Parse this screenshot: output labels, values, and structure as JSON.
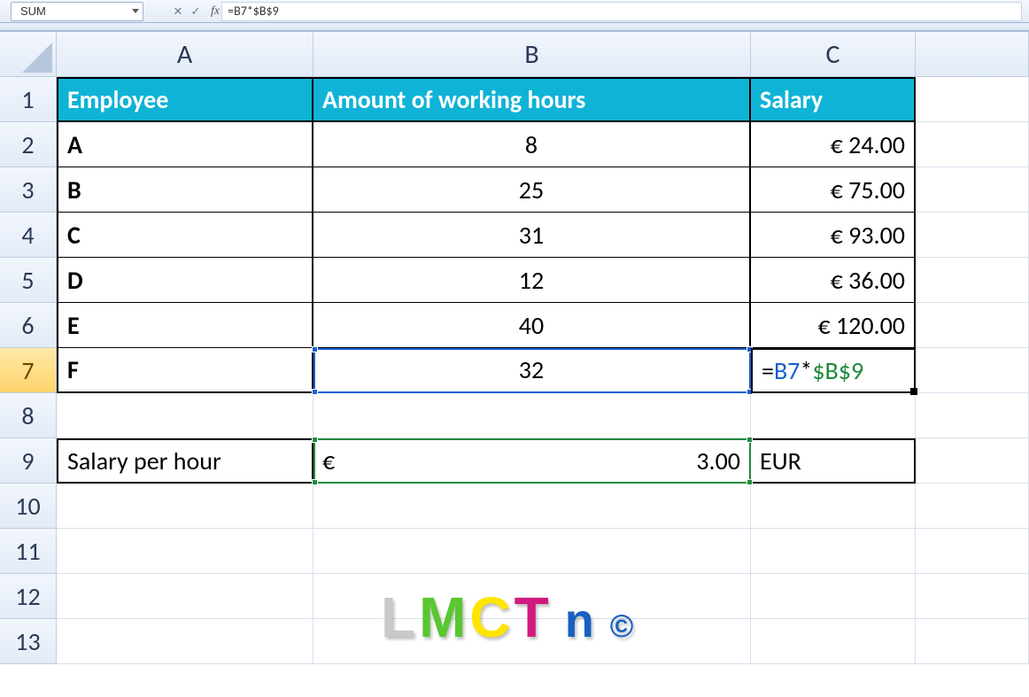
{
  "formula_bar": {
    "name_box": "SUM",
    "fx_label": "fx",
    "cancel": "✕",
    "accept": "✓",
    "formula": "=B7*$B$9"
  },
  "columns": [
    "A",
    "B",
    "C"
  ],
  "rows": [
    "1",
    "2",
    "3",
    "4",
    "5",
    "6",
    "7",
    "8",
    "9",
    "10",
    "11",
    "12",
    "13"
  ],
  "headers": {
    "A": "Employee",
    "B": "Amount of working hours",
    "C": "Salary"
  },
  "data_rows": [
    {
      "emp": "A",
      "hours": "8",
      "salary": "€  24.00"
    },
    {
      "emp": "B",
      "hours": "25",
      "salary": "€  75.00"
    },
    {
      "emp": "C",
      "hours": "31",
      "salary": "€  93.00"
    },
    {
      "emp": "D",
      "hours": "12",
      "salary": "€  36.00"
    },
    {
      "emp": "E",
      "hours": "40",
      "salary": "€ 120.00"
    },
    {
      "emp": "F",
      "hours": "32",
      "salary": "=B7*$B$9"
    }
  ],
  "salary_per_hour": {
    "label": "Salary per hour",
    "currency": "€",
    "amount": "3.00",
    "unit": "EUR"
  },
  "active_cell_formula": {
    "ref1": "B7",
    "op": "*",
    "ref2": "$B$9",
    "eq": "="
  },
  "logo": {
    "l1": "L",
    "l2": "M",
    "l3": "C",
    "l4": "T",
    "l5": "n",
    "l6": "©"
  }
}
